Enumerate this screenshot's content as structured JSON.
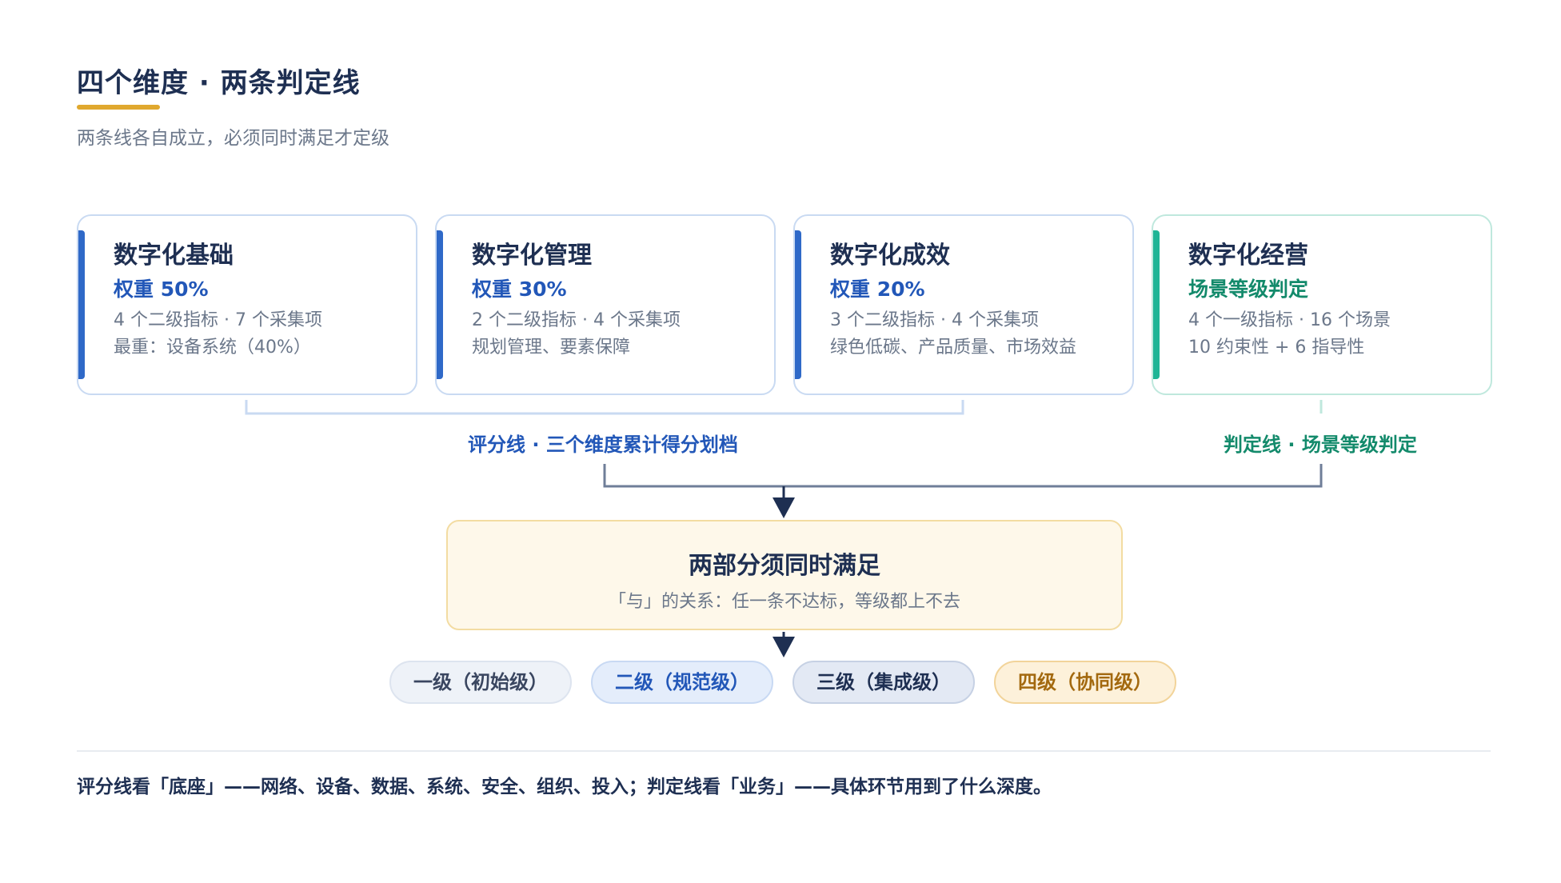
{
  "header": {
    "title": "四个维度 · 两条判定线",
    "subtitle": "两条线各自成立，必须同时满足才定级"
  },
  "cards": [
    {
      "title": "数字化基础",
      "weight": "权重 50%",
      "line1": "4 个二级指标 · 7 个采集项",
      "line2": "最重：设备系统（40%）"
    },
    {
      "title": "数字化管理",
      "weight": "权重 30%",
      "line1": "2 个二级指标 · 4 个采集项",
      "line2": "规划管理、要素保障"
    },
    {
      "title": "数字化成效",
      "weight": "权重 20%",
      "line1": "3 个二级指标 · 4 个采集项",
      "line2": "绿色低碳、产品质量、市场效益"
    },
    {
      "title": "数字化经营",
      "weight": "场景等级判定",
      "line1": "4 个一级指标 · 16 个场景",
      "line2": "10 约束性 + 6 指导性"
    }
  ],
  "lines": {
    "score_label": "评分线 · 三个维度累计得分划档",
    "judge_label": "判定线 · 场景等级判定"
  },
  "center": {
    "title": "两部分须同时满足",
    "subtitle": "「与」的关系：任一条不达标，等级都上不去"
  },
  "levels": [
    "一级（初始级）",
    "二级（规范级）",
    "三级（集成级）",
    "四级（协同级）"
  ],
  "footer": {
    "note": "评分线看「底座」——网络、设备、数据、系统、安全、组织、投入；判定线看「业务」——具体环节用到了什么深度。"
  },
  "colors": {
    "accent_gold": "#e0a82e",
    "score_blue": "#2257b8",
    "judge_teal": "#138a6b",
    "navy": "#1e2f52"
  }
}
